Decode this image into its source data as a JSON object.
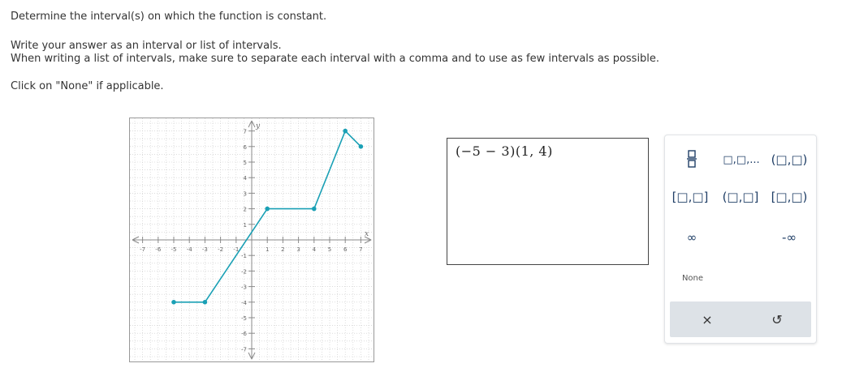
{
  "question": {
    "line1": "Determine the interval(s) on which the function is constant.",
    "line2": "Write your answer as an interval or list of intervals.",
    "line3": "When writing a list of intervals, make sure to separate each interval with a comma and to use as few intervals as possible.",
    "line4": "Click on \"None\" if applicable."
  },
  "graph": {
    "x_axis_label": "x",
    "y_axis_label": "y",
    "x_ticks": [
      "-7",
      "-6",
      "-5",
      "-4",
      "-3",
      "-2",
      "-1",
      "1",
      "2",
      "3",
      "4",
      "5",
      "6",
      "7"
    ],
    "y_ticks": [
      "7",
      "6",
      "5",
      "4",
      "3",
      "2",
      "1",
      "-1",
      "-2",
      "-3",
      "-4",
      "-5",
      "-6",
      "-7"
    ],
    "line_color": "#1aa0b5",
    "grid_color": "#c8c8c8",
    "axis_range": [
      -7,
      7
    ],
    "points": [
      [
        -5,
        -4
      ],
      [
        -3,
        -4
      ],
      [
        1,
        2
      ],
      [
        4,
        2
      ],
      [
        6,
        7
      ],
      [
        7,
        6
      ]
    ],
    "filled_endpoints": [
      [
        -5,
        -4
      ],
      [
        -3,
        -4
      ],
      [
        1,
        2
      ],
      [
        4,
        2
      ],
      [
        6,
        7
      ],
      [
        7,
        6
      ]
    ]
  },
  "answer": {
    "value": "(−5 − 3)(1, 4)"
  },
  "palette": {
    "fraction": "fraction",
    "list": "□,□,...",
    "open_open": "(□,□)",
    "closed_closed": "[□,□]",
    "open_closed": "(□,□]",
    "closed_open": "[□,□)",
    "infinity": "∞",
    "neg_infinity": "-∞",
    "none": "None",
    "clear": "×",
    "undo": "↺"
  }
}
